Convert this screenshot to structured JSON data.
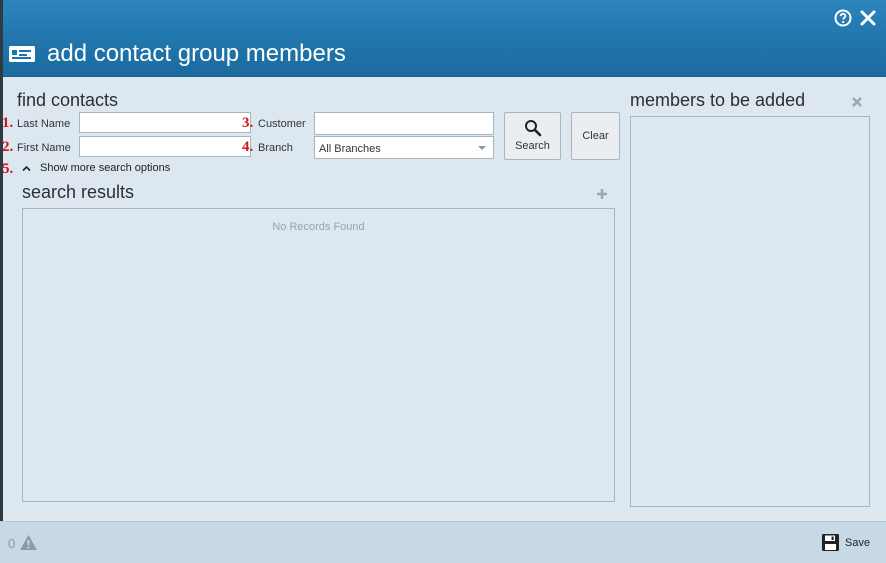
{
  "dialog": {
    "title": "add contact group members",
    "title_icon": "contact-card-icon",
    "help_icon": "help-circle-icon",
    "close_icon": "close-icon"
  },
  "find_contacts": {
    "heading": "find contacts",
    "markers": [
      "1.",
      "2.",
      "3.",
      "4.",
      "5."
    ],
    "last_name": {
      "label": "Last Name",
      "value": ""
    },
    "first_name": {
      "label": "First Name",
      "value": ""
    },
    "customer": {
      "label": "Customer",
      "value": ""
    },
    "branch": {
      "label": "Branch",
      "selected": "All Branches"
    },
    "search_button": "Search",
    "clear_button": "Clear",
    "more_options": "Show more search options"
  },
  "search_results": {
    "heading": "search results",
    "empty_text": "No Records Found",
    "add_icon": "plus-icon"
  },
  "members": {
    "heading": "members to be added",
    "remove_icon": "close-icon"
  },
  "footer": {
    "warning_count": "0",
    "warning_icon": "warning-icon",
    "save_label": "Save",
    "save_icon": "floppy-disk-icon"
  },
  "colors": {
    "titlebar": "#1f74aa",
    "body": "#dce7ef",
    "footer": "#c7d9e5",
    "marker_red": "#d11616"
  }
}
